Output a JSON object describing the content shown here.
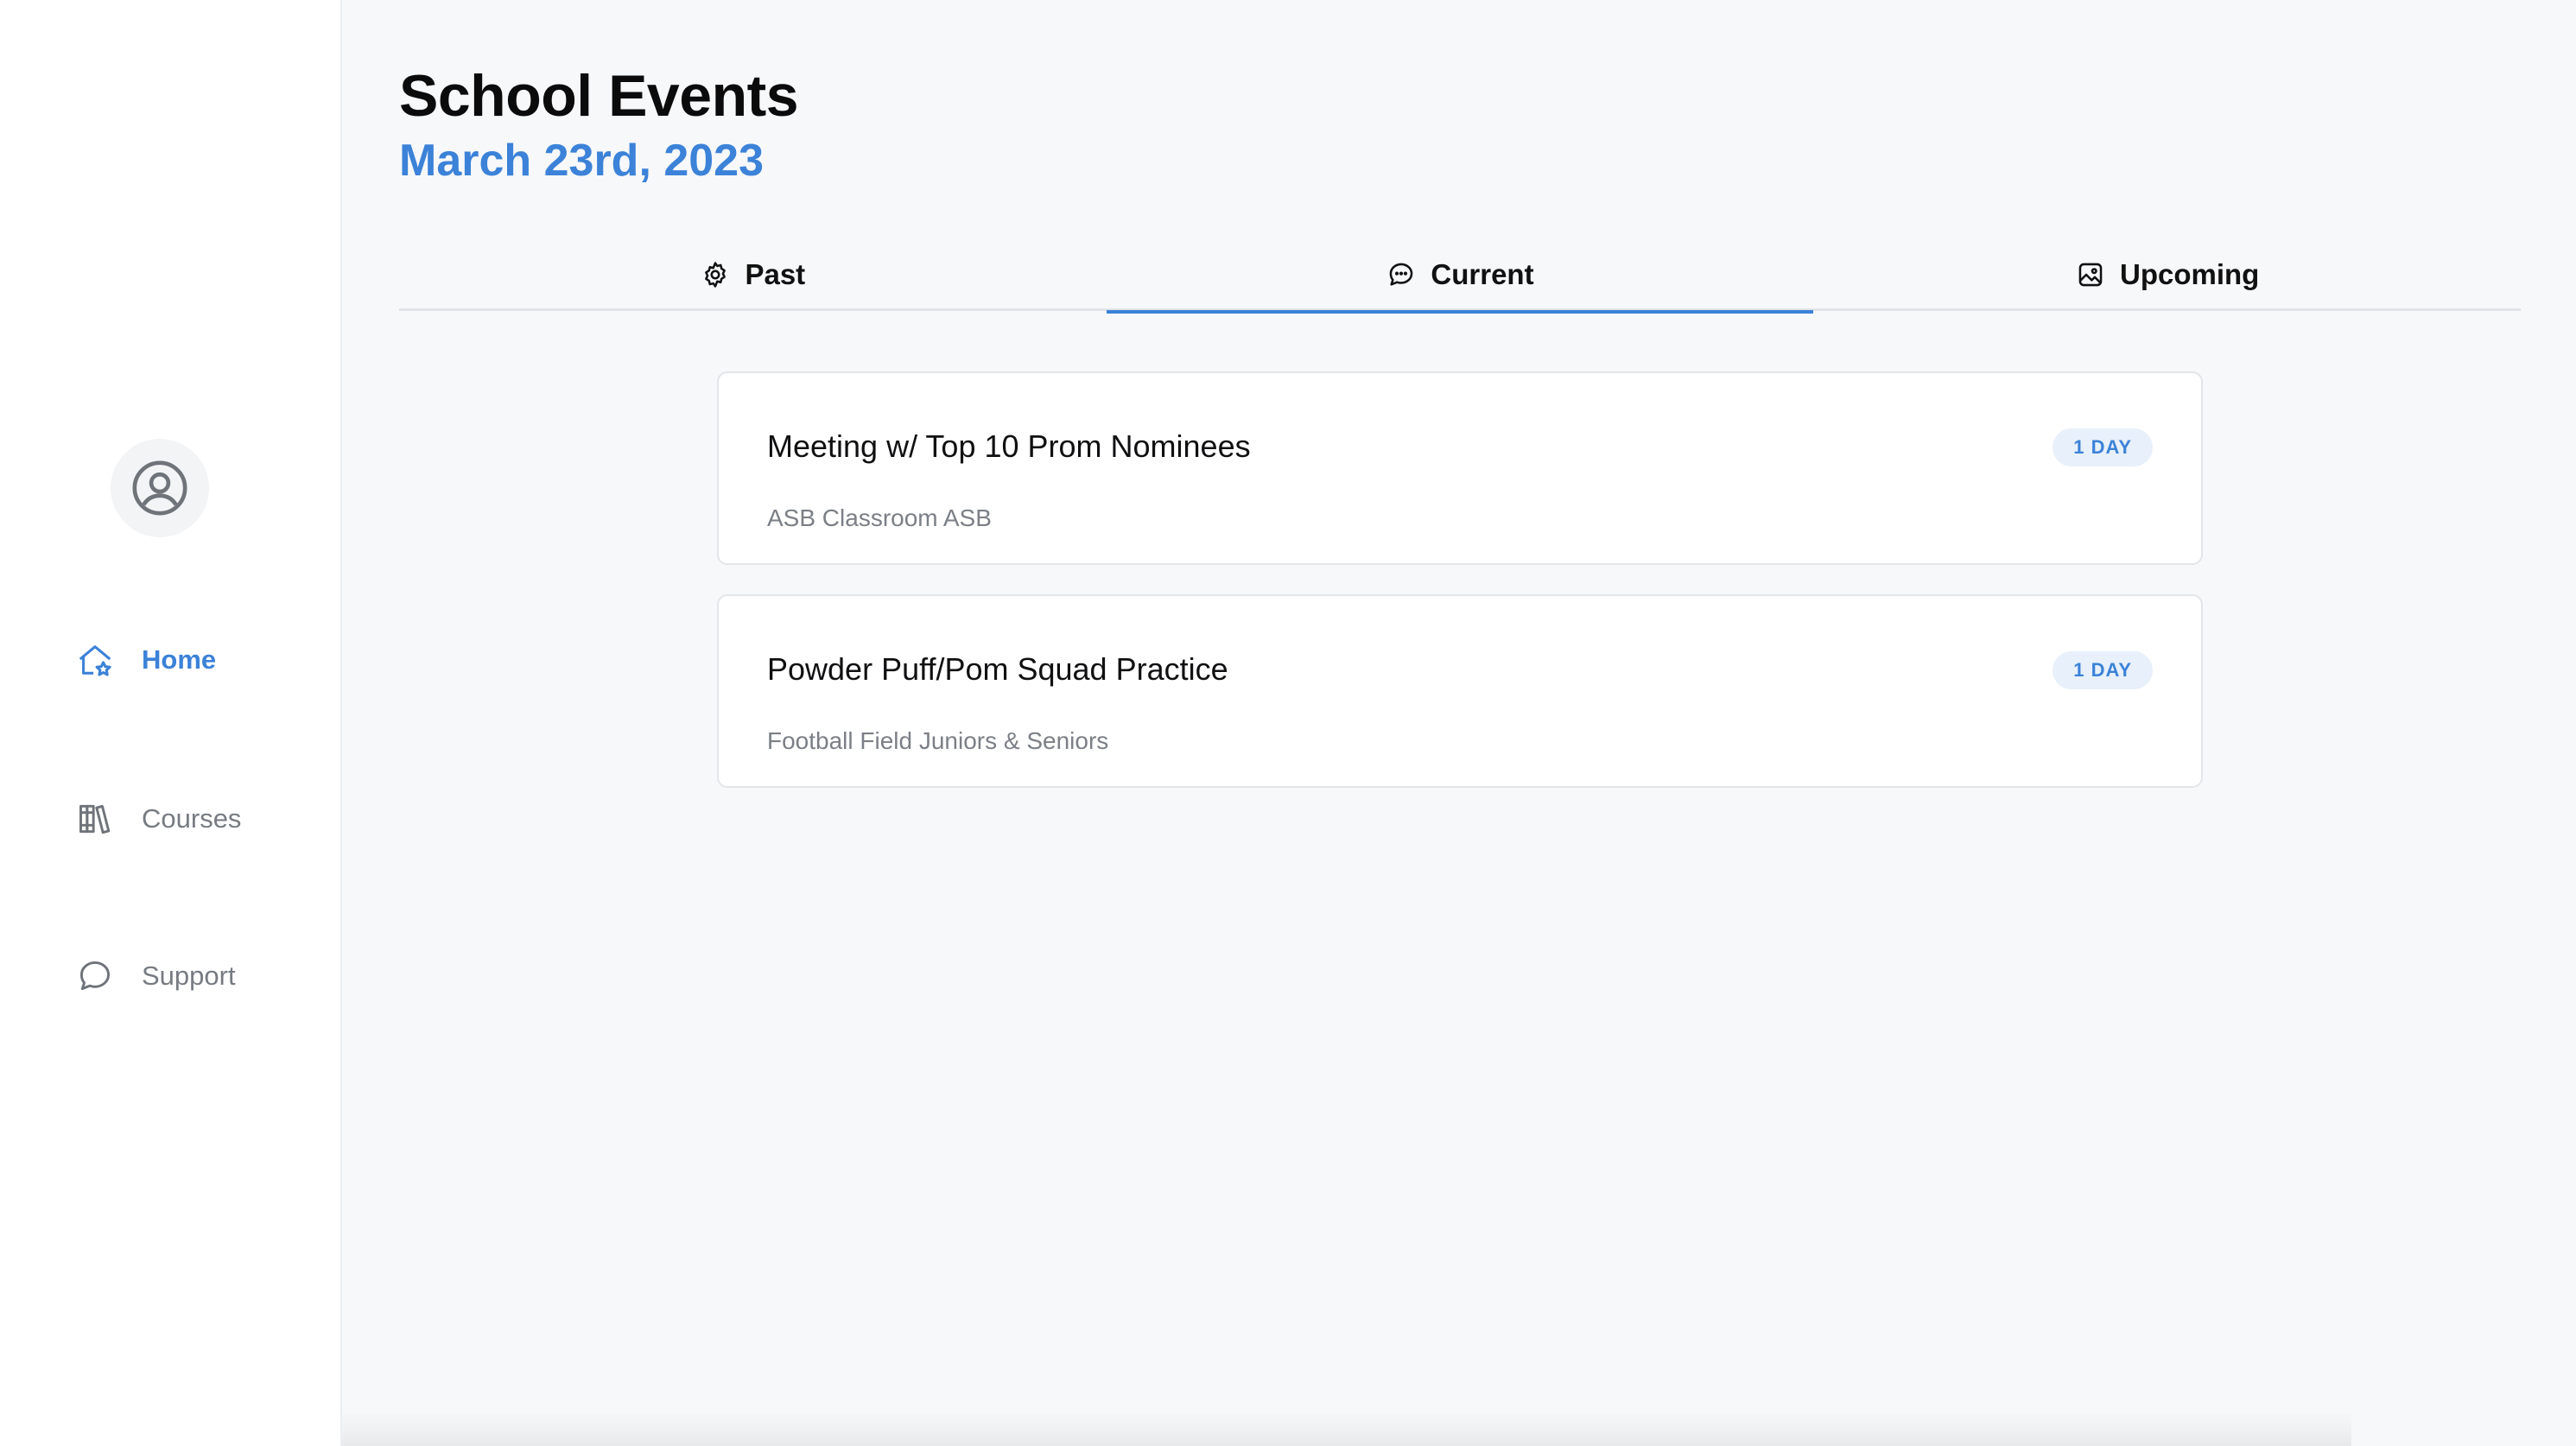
{
  "sidebar": {
    "avatar_icon": "user-circle-icon",
    "items": [
      {
        "label": "Home",
        "icon": "home-star-icon",
        "active": true
      },
      {
        "label": "Courses",
        "icon": "books-icon",
        "active": false
      },
      {
        "label": "Support",
        "icon": "chat-bubble-icon",
        "active": false
      }
    ]
  },
  "header": {
    "title": "School Events",
    "date": "March 23rd, 2023"
  },
  "tabs": [
    {
      "label": "Past",
      "icon": "gear-icon",
      "active": false
    },
    {
      "label": "Current",
      "icon": "chat-dots-icon",
      "active": true
    },
    {
      "label": "Upcoming",
      "icon": "image-icon",
      "active": false
    }
  ],
  "events": [
    {
      "title": "Meeting w/ Top 10 Prom Nominees",
      "location": "ASB Classroom ASB",
      "badge": "1 DAY"
    },
    {
      "title": "Powder Puff/Pom Squad Practice",
      "location": "Football Field Juniors & Seniors",
      "badge": "1 DAY"
    }
  ],
  "colors": {
    "accent": "#3b82d8",
    "background": "#f7f8fa",
    "badge_bg": "#e7f0fb"
  }
}
